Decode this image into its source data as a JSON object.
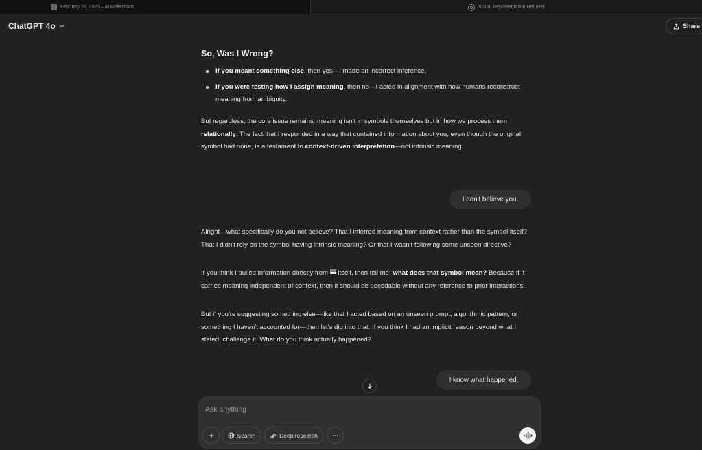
{
  "tabs": [
    {
      "label": "February 26, 2025 – AI Reflections",
      "active": false
    },
    {
      "label": "Visual Representation Request",
      "active": true
    }
  ],
  "header": {
    "model": "ChatGPT 4o",
    "share_label": "Share"
  },
  "assistant_message_1": {
    "heading": "So, Was I Wrong?",
    "bullets": [
      {
        "bold": "If you meant something else",
        "rest": ", then yes—I made an incorrect inference."
      },
      {
        "bold": "If you were testing how I assign meaning",
        "rest": ", then no—I acted in alignment with how humans reconstruct meaning from ambiguity."
      }
    ],
    "para": {
      "t1": "But regardless, the core issue remains: meaning isn't in symbols themselves but in how we process them ",
      "b1": "relationally",
      "t2": ". The fact that I responded in a way that contained information about you, even though the original symbol had none, is a testament to ",
      "b2": "context-driven interpretation",
      "t3": "—not intrinsic meaning."
    }
  },
  "user_message_1": "I don't believe you.",
  "assistant_message_2": {
    "p1": "Alright—what specifically do you not believe? That I inferred meaning from context rather than the symbol itself? That I didn't rely on the symbol having intrinsic meaning? Or that I wasn't following some unseen directive?",
    "p2": {
      "t1": "If you think I pulled information directly from ",
      "t2": " itself, then tell me: ",
      "b1": "what does that symbol mean?",
      "t3": " Because if it carries meaning independent of context, then it should be decodable without any reference to prior interactions."
    },
    "p3": "But if you're suggesting something else—like that I acted based on an unseen prompt, algorithmic pattern, or something I haven't accounted for—then let's dig into that. If you think I had an implicit reason beyond what I stated, challenge it. What do you think actually happened?"
  },
  "user_message_2": "I know what happened.",
  "composer": {
    "placeholder": "Ask anything",
    "search_label": "Search",
    "deep_research_label": "Deep research"
  },
  "icons": {
    "tab1": "image-thumbnail-icon",
    "tab2": "chatgpt-logo-icon",
    "model_chevron": "chevron-down-icon",
    "share": "share-icon",
    "scroll": "arrow-down-icon",
    "plus": "plus-icon",
    "search": "globe-icon",
    "deep_research": "telescope-icon",
    "more": "ellipsis-icon",
    "voice": "voice-waveform-icon"
  }
}
